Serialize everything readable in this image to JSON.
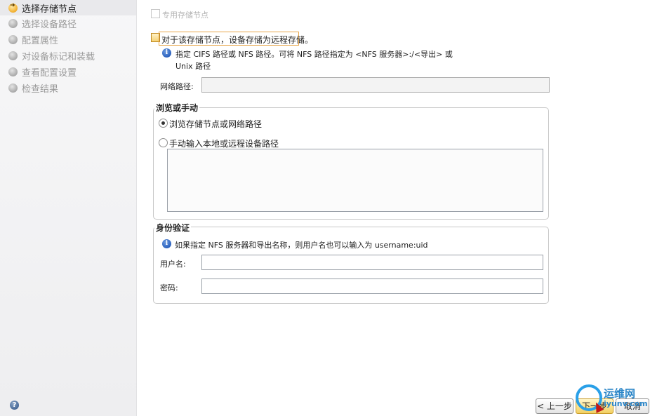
{
  "sidebar": {
    "steps": [
      {
        "label": "选择存储节点",
        "active": true
      },
      {
        "label": "选择设备路径",
        "active": false
      },
      {
        "label": "配置属性",
        "active": false
      },
      {
        "label": "对设备标记和装载",
        "active": false
      },
      {
        "label": "查看配置设置",
        "active": false
      },
      {
        "label": "检查结果",
        "active": false
      }
    ],
    "help_icon": "help-icon"
  },
  "main": {
    "dedicated_node_checkbox_label": "专用存储节点",
    "remote_storage_checkbox_label": "对于该存储节点，设备存储为远程存储。",
    "info_line1": "指定 CIFS 路径或 NFS 路径。可将 NFS 路径指定为 <NFS 服务器>:/<导出> 或",
    "info_line2": "Unix 路径",
    "network_path_label": "网络路径:",
    "network_path_value": "",
    "browse_group_title": "浏览或手动",
    "radio_browse_label": "浏览存储节点或网络路径",
    "radio_manual_label": "手动输入本地或远程设备路径",
    "auth_group_title": "身份验证",
    "auth_info": "如果指定 NFS 服务器和导出名称，则用户名也可以输入为 username:uid",
    "username_label": "用户名:",
    "username_value": "",
    "password_label": "密码:",
    "password_value": ""
  },
  "footer": {
    "back_label": "< 上一步",
    "next_label": "下一步",
    "cancel_label": "取消"
  },
  "watermark": {
    "text1": "运维网",
    "text2": "iyunv.com"
  },
  "colors": {
    "accent": "#f2cf61",
    "info_blue": "#1f57b8",
    "focus_orange": "#e8a64a"
  }
}
